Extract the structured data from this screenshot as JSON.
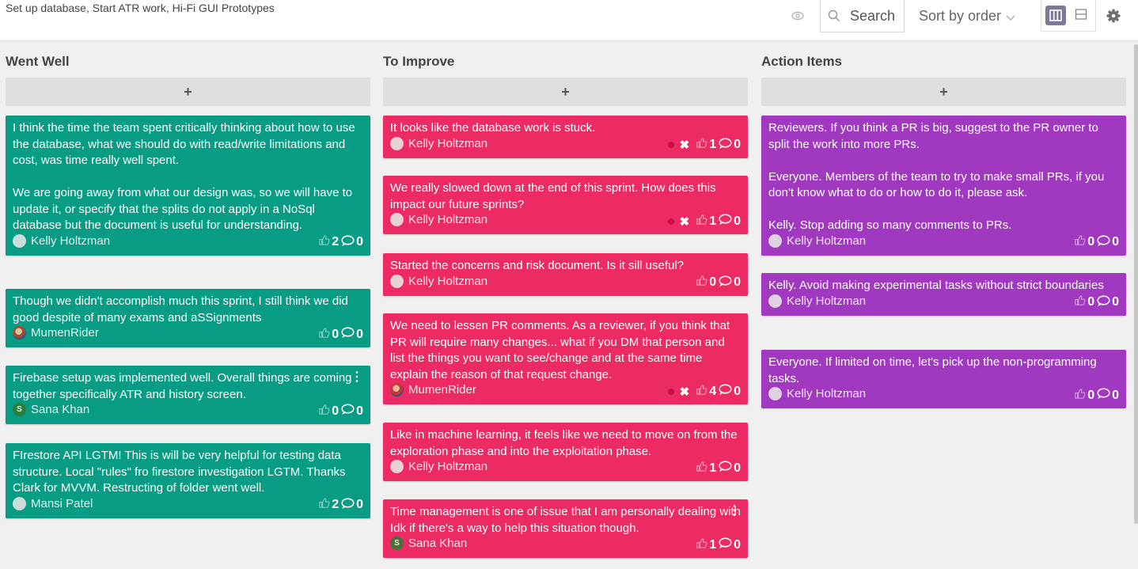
{
  "board_title": "Set up database, Start ATR work, Hi-Fi GUI Prototypes",
  "toolbar": {
    "search_label": "Search",
    "sort_label": "Sort by order"
  },
  "colors": {
    "went_well": "#079c83",
    "to_improve": "#ec2b64",
    "action_items": "#a139c0"
  },
  "columns": [
    {
      "title": "Went Well",
      "add_label": "+",
      "cards": [
        {
          "text": "I think the time the team spent critically thinking about how to use the database, what we should do with read/write limitations and cost, was time really well spent.\n\nWe are going away from what our design was, so we will have to update it, or specify that the splits do not apply in a NoSql database but the document is useful for understanding.",
          "author": "Kelly Holtzman",
          "votes": "2",
          "comments": "0"
        },
        {
          "text": "Though we didn't accomplish much this sprint, I still think we did good despite of many exams and aSSignments",
          "author": "MumenRider",
          "votes": "0",
          "comments": "0"
        },
        {
          "text": "Firebase setup was implemented well. Overall things are coming together specifically ATR and history screen.",
          "author": "Sana Khan",
          "avatar_letter": "S",
          "votes": "0",
          "comments": "0",
          "menu": "⋮"
        },
        {
          "text": "FIrestore API LGTM! This is will be very helpful for testing data structure. Local \"rules\" fro firestore investigation LGTM. Thanks Clark for MVVM. Restructing of folder went well.",
          "author": "Mansi Patel",
          "votes": "2",
          "comments": "0"
        }
      ]
    },
    {
      "title": "To Improve",
      "add_label": "+",
      "cards": [
        {
          "text": "It looks like the database work is stuck.",
          "author": "Kelly Holtzman",
          "votes": "1",
          "comments": "0",
          "delete_glyph": "✖"
        },
        {
          "text": "We really slowed down at the end of this sprint. How does this impact our future sprints?",
          "author": "Kelly Holtzman",
          "votes": "1",
          "comments": "0",
          "delete_glyph": "✖"
        },
        {
          "text": "Started the concerns and risk document. Is it sill useful?",
          "author": "Kelly Holtzman",
          "votes": "0",
          "comments": "0"
        },
        {
          "text": "We need to lessen PR comments. As a reviewer, if you think that PR will require many changes... what if you DM that person and list the things you want to see/change and at the same time explain the reason of that request change.",
          "author": "MumenRider",
          "votes": "4",
          "comments": "0",
          "delete_glyph": "✖"
        },
        {
          "text": "Like in machine learning, it feels like we need to move on from the exploration phase and into the exploitation phase.",
          "author": "Kelly Holtzman",
          "votes": "1",
          "comments": "0"
        },
        {
          "text": "Time management is one of issue that I am personally dealing with Idk if there's a way to help this situation though.",
          "author": "Sana Khan",
          "avatar_letter": "S",
          "votes": "1",
          "comments": "0",
          "menu": "⋮"
        }
      ]
    },
    {
      "title": "Action Items",
      "add_label": "+",
      "cards": [
        {
          "text": "Reviewers. If you think a PR is big, suggest to the PR owner to split the work into more PRs.\n\nEveryone. Members of the team to try to make small PRs, if you don't know what to do or how to do it, please ask.\n\nKelly. Stop adding so many comments to PRs.",
          "author": "Kelly Holtzman",
          "votes": "0",
          "comments": "0"
        },
        {
          "text": "Kelly. Avoid making experimental tasks without strict boundaries",
          "author": "Kelly Holtzman",
          "votes": "0",
          "comments": "0"
        },
        {
          "text": "Everyone. If limited on time, let's pick up the non-programming tasks.",
          "author": "Kelly Holtzman",
          "votes": "0",
          "comments": "0"
        }
      ]
    }
  ]
}
